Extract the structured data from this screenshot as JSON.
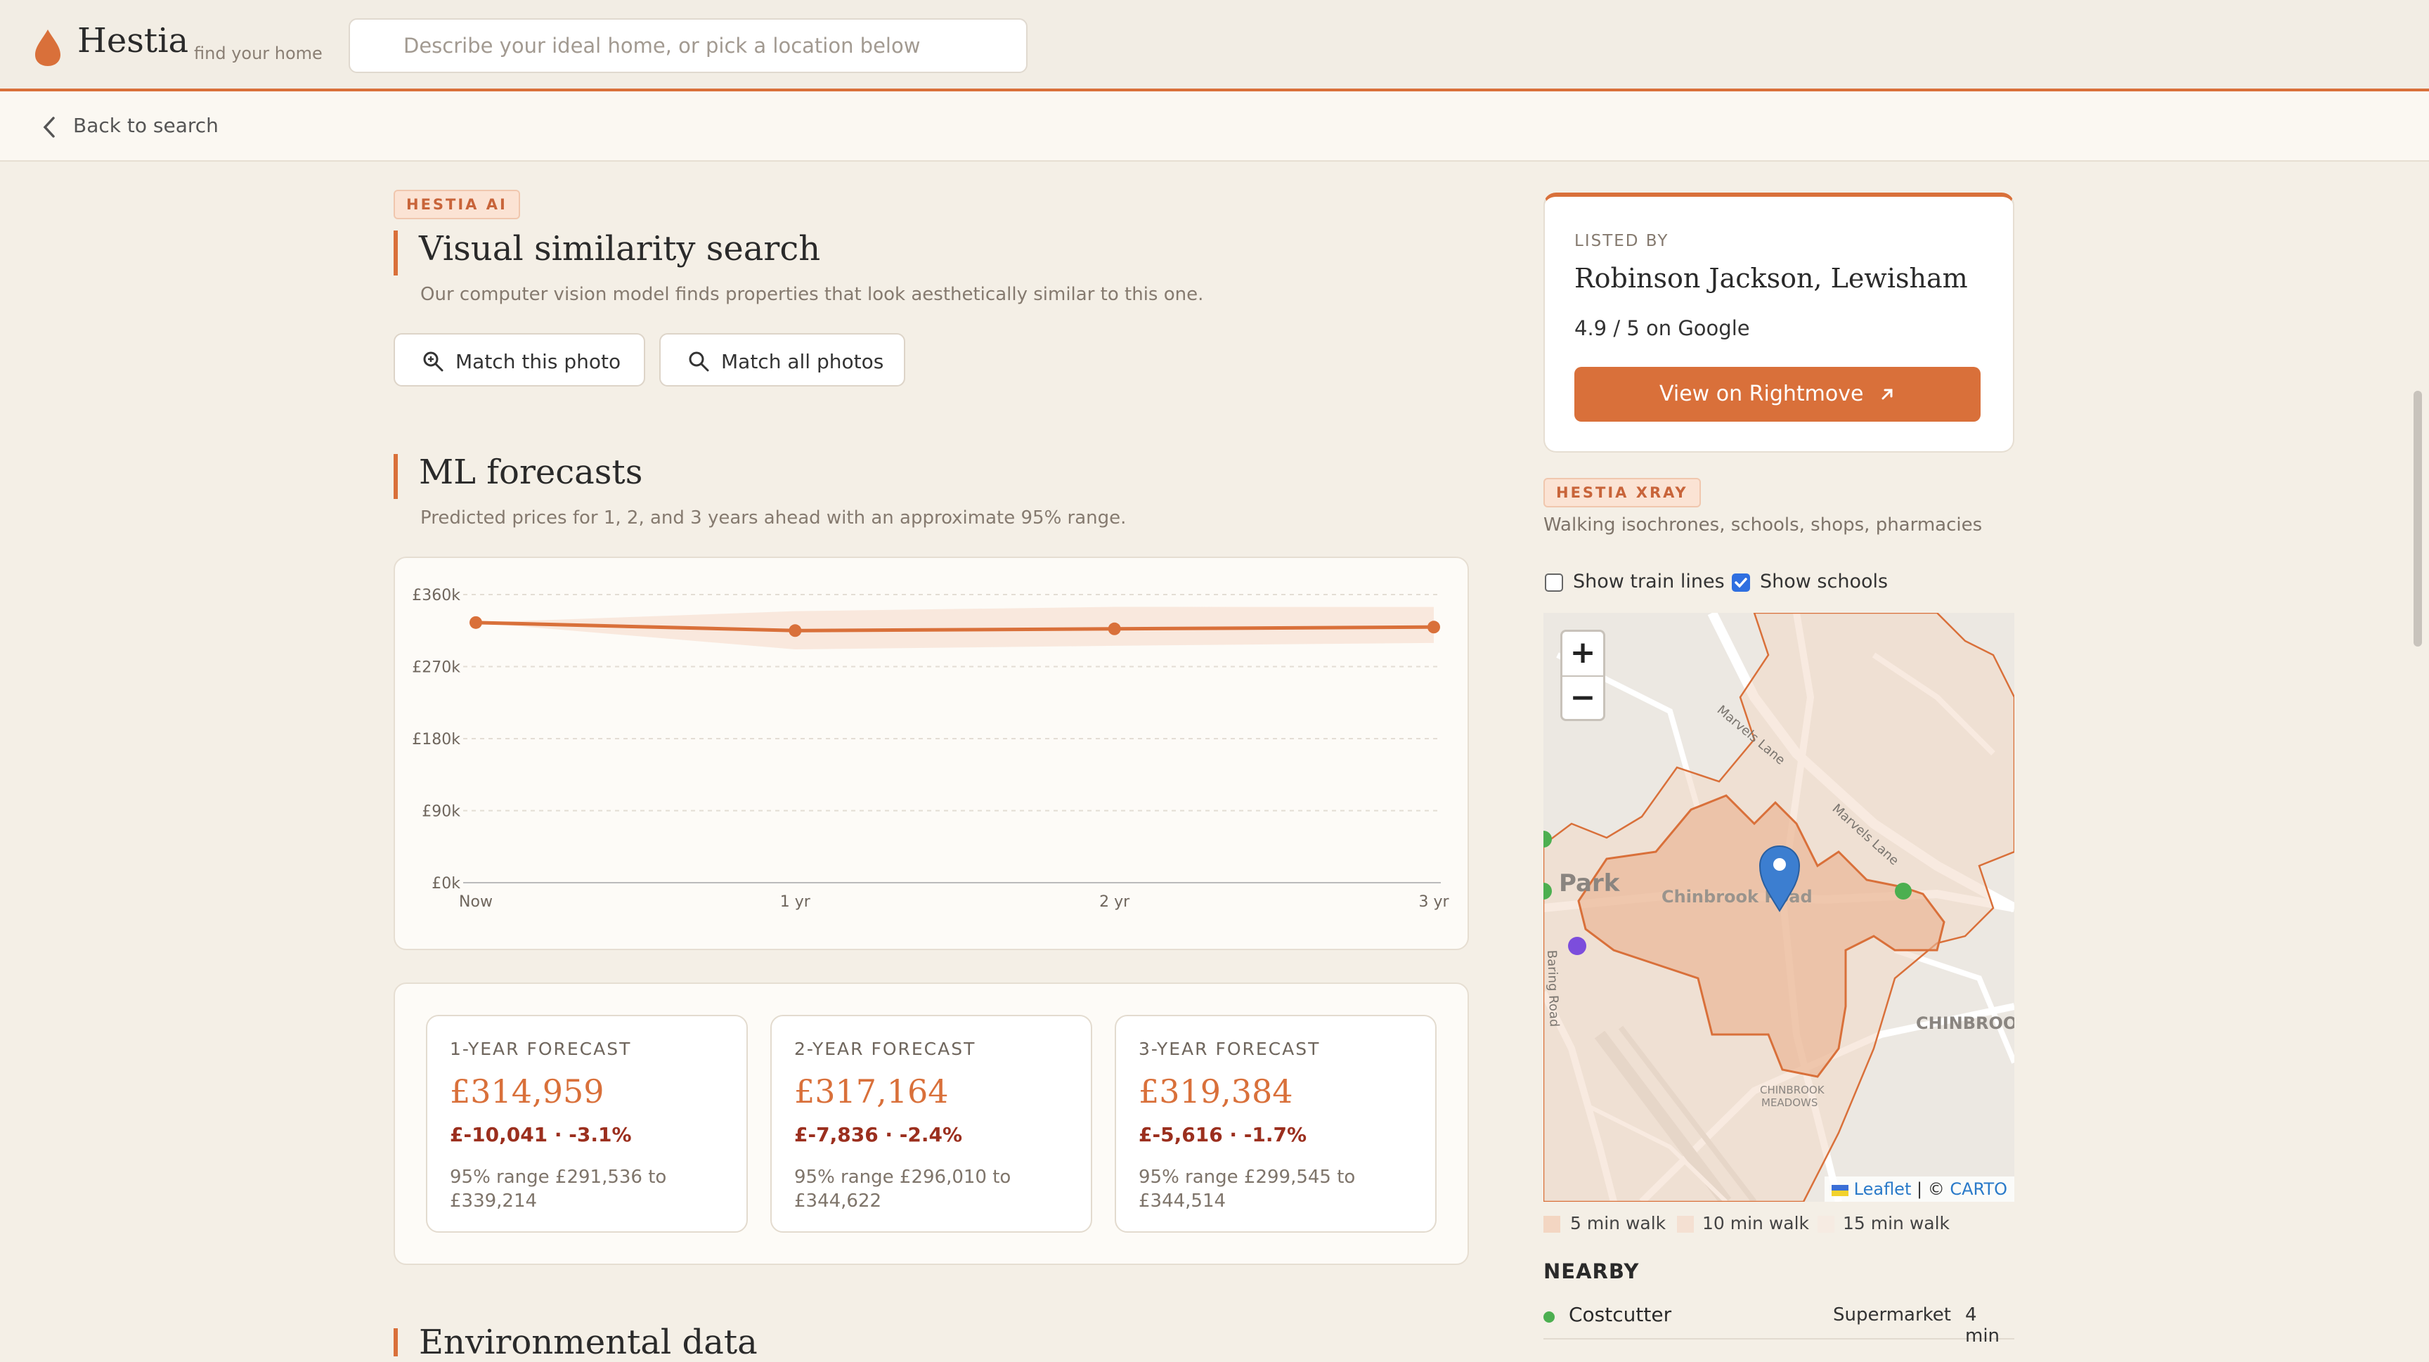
{
  "header": {
    "brand": "Hestia",
    "tagline": "find your home",
    "search_placeholder": "Describe your ideal home, or pick a location below",
    "back_label": "Back to search"
  },
  "visual_search": {
    "tag": "HESTIA AI",
    "title": "Visual similarity search",
    "subtitle": "Our computer vision model finds properties that look aesthetically similar to this one.",
    "match_photo_label": "Match this photo",
    "match_all_label": "Match all photos"
  },
  "forecasts": {
    "title": "ML forecasts",
    "subtitle": "Predicted prices for 1, 2, and 3 years ahead with an approximate 95% range.",
    "cards": [
      {
        "label": "1-YEAR FORECAST",
        "value": "£314,959",
        "delta": "£-10,041 · -3.1%",
        "range": "95% range £291,536 to £339,214"
      },
      {
        "label": "2-YEAR FORECAST",
        "value": "£317,164",
        "delta": "£-7,836 · -2.4%",
        "range": "95% range £296,010 to £344,622"
      },
      {
        "label": "3-YEAR FORECAST",
        "value": "£319,384",
        "delta": "£-5,616 · -1.7%",
        "range": "95% range £299,545 to £344,514"
      }
    ]
  },
  "chart_data": {
    "type": "line",
    "categories": [
      "Now",
      "1 yr",
      "2 yr",
      "3 yr"
    ],
    "values": [
      325000,
      314959,
      317164,
      319384
    ],
    "band_low": [
      325000,
      291536,
      296010,
      299545
    ],
    "band_high": [
      325000,
      339214,
      344622,
      344514
    ],
    "yticks": [
      "£360k",
      "£270k",
      "£180k",
      "£90k",
      "£0k"
    ],
    "ylim": [
      0,
      360000
    ],
    "grid": true,
    "color": "#d9703a"
  },
  "agent": {
    "listed_by_label": "LISTED BY",
    "name": "Robinson Jackson, Lewisham",
    "rating": "4.9 / 5 on Google",
    "cta_label": "View on Rightmove"
  },
  "xray": {
    "tag": "HESTIA XRAY",
    "subtitle": "Walking isochrones, schools, shops, pharmacies",
    "show_train_lines_label": "Show train lines",
    "show_train_lines_checked": false,
    "show_schools_label": "Show schools",
    "show_schools_checked": true
  },
  "map": {
    "zoom_in": "+",
    "zoom_out": "−",
    "labels": {
      "park": "Park",
      "chinbrook_road": "Chinbrook Road",
      "marvels_lane_1": "Marvels Lane",
      "marvels_lane_2": "Marvels Lane",
      "baring_road": "Baring Road",
      "chinbrook": "CHINBROOK",
      "meadows_1": "CHINBROOK",
      "meadows_2": "MEADOWS"
    },
    "attribution_leaflet": "Leaflet",
    "attribution_sep": " | © ",
    "attribution_carto": "CARTO"
  },
  "legend": [
    {
      "label": "5 min walk",
      "color": "#f3d6c2"
    },
    {
      "label": "10 min walk",
      "color": "#f4e0d2"
    },
    {
      "label": "15 min walk",
      "color": "#f6ebe2"
    }
  ],
  "nearby": {
    "title": "NEARBY",
    "items": [
      {
        "name": "Costcutter",
        "type": "Supermarket",
        "time": "4 min"
      }
    ]
  },
  "next_section_title": "Environmental data"
}
